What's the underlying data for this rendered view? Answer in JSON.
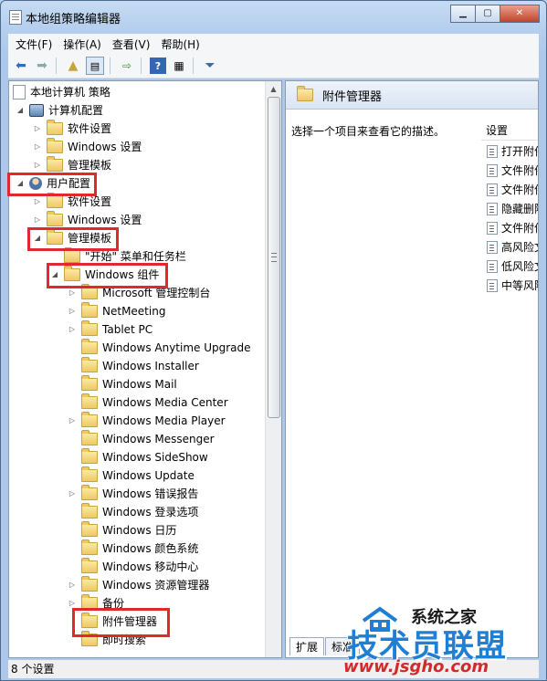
{
  "window": {
    "title": "本地组策略编辑器",
    "controls": {
      "minimize": "▁",
      "maximize": "▢",
      "close": "✕"
    }
  },
  "menu": [
    "文件(F)",
    "操作(A)",
    "查看(V)",
    "帮助(H)"
  ],
  "toolbar": [
    "back-icon",
    "forward-icon",
    "up-folder-icon",
    "show-tree-icon",
    "export-icon",
    "help-icon",
    "properties-icon",
    "filter-icon"
  ],
  "tree": {
    "root": "本地计算机 策略",
    "computer_config": "计算机配置",
    "cc_software": "软件设置",
    "cc_windows": "Windows 设置",
    "cc_admin": "管理模板",
    "user_config": "用户配置",
    "uc_software": "软件设置",
    "uc_windows": "Windows 设置",
    "uc_admin": "管理模板",
    "start_menu": "\"开始\" 菜单和任务栏",
    "windows_components": "Windows 组件",
    "components": [
      "Microsoft 管理控制台",
      "NetMeeting",
      "Tablet PC",
      "Windows Anytime Upgrade",
      "Windows Installer",
      "Windows Mail",
      "Windows Media Center",
      "Windows Media Player",
      "Windows Messenger",
      "Windows SideShow",
      "Windows Update",
      "Windows 错误报告",
      "Windows 登录选项",
      "Windows 日历",
      "Windows 颜色系统",
      "Windows 移动中心",
      "Windows 资源管理器",
      "备份",
      "附件管理器",
      "即时搜索"
    ]
  },
  "right": {
    "header_title": "附件管理器",
    "description": "选择一个项目来查看它的描述。",
    "settings_header": "设置",
    "settings": [
      "打开附件",
      "文件附件",
      "文件附件",
      "隐藏删除",
      "文件附件",
      "高风险文",
      "低风险文",
      "中等风险"
    ],
    "tabs": [
      "扩展",
      "标准"
    ]
  },
  "status": "8 个设置",
  "watermark": {
    "top": "系统之家",
    "big": "技术员联盟",
    "url": "www.jsgho.com"
  }
}
